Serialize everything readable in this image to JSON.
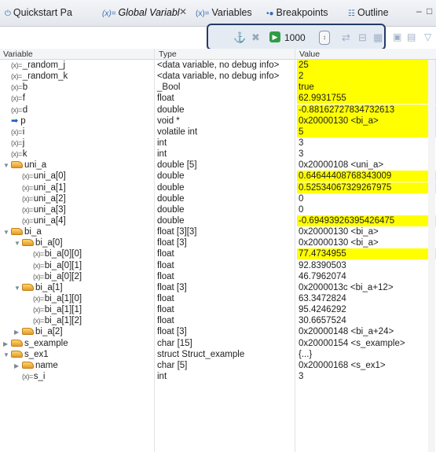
{
  "tabs": [
    {
      "label": "Quickstart Pa",
      "icon": "⏻"
    },
    {
      "label": "Global Variabl",
      "icon": "(x)="
    },
    {
      "label": "Variables",
      "icon": "(x)="
    },
    {
      "label": "Breakpoints",
      "icon": "•●"
    },
    {
      "label": "Outline",
      "icon": "☷"
    }
  ],
  "toolbar": {
    "count": "1000"
  },
  "columns": [
    "Variable",
    "Type",
    "Value"
  ],
  "rows": [
    {
      "indent": 0,
      "icon": "var",
      "name": "_random_j",
      "type": "<data variable, no debug info>",
      "value": "25",
      "hl": true
    },
    {
      "indent": 0,
      "icon": "var",
      "name": "_random_k",
      "type": "<data variable, no debug info>",
      "value": "2",
      "hl": true
    },
    {
      "indent": 0,
      "icon": "var",
      "name": "b",
      "type": "_Bool",
      "value": "true",
      "hl": true
    },
    {
      "indent": 0,
      "icon": "var",
      "name": "f",
      "type": "float",
      "value": "62.9931755",
      "hl": true
    },
    {
      "indent": 0,
      "icon": "var",
      "name": "d",
      "type": "double",
      "value": "-0.88162727834732613",
      "hl": true
    },
    {
      "indent": 0,
      "icon": "ptr",
      "name": "p",
      "type": "void *",
      "value": "0x20000130 <bi_a>",
      "hl": true
    },
    {
      "indent": 0,
      "icon": "var",
      "name": "i",
      "type": "volatile int",
      "value": "5",
      "hl": true
    },
    {
      "indent": 0,
      "icon": "var",
      "name": "j",
      "type": "int",
      "value": "3",
      "hl": false
    },
    {
      "indent": 0,
      "icon": "var",
      "name": "k",
      "type": "int",
      "value": "3",
      "hl": false
    },
    {
      "indent": 0,
      "icon": "folder",
      "expand": "open",
      "name": "uni_a",
      "type": "double [5]",
      "value": "0x20000108 <uni_a>",
      "hl": false
    },
    {
      "indent": 1,
      "icon": "var",
      "name": "uni_a[0]",
      "type": "double",
      "value": "0.64644408768343009",
      "hl": true
    },
    {
      "indent": 1,
      "icon": "var",
      "name": "uni_a[1]",
      "type": "double",
      "value": "0.52534067329267975",
      "hl": true
    },
    {
      "indent": 1,
      "icon": "var",
      "name": "uni_a[2]",
      "type": "double",
      "value": "0",
      "hl": false
    },
    {
      "indent": 1,
      "icon": "var",
      "name": "uni_a[3]",
      "type": "double",
      "value": "0",
      "hl": false
    },
    {
      "indent": 1,
      "icon": "var",
      "name": "uni_a[4]",
      "type": "double",
      "value": "-0.69493926395426475",
      "hl": true
    },
    {
      "indent": 0,
      "icon": "folder",
      "expand": "open",
      "name": "bi_a",
      "type": "float [3][3]",
      "value": "0x20000130 <bi_a>",
      "hl": false
    },
    {
      "indent": 1,
      "icon": "folder",
      "expand": "open",
      "name": "bi_a[0]",
      "type": "float [3]",
      "value": "0x20000130 <bi_a>",
      "hl": false
    },
    {
      "indent": 2,
      "icon": "var",
      "name": "bi_a[0][0]",
      "type": "float",
      "value": "77.4734955",
      "hl": true
    },
    {
      "indent": 2,
      "icon": "var",
      "name": "bi_a[0][1]",
      "type": "float",
      "value": "92.8390503",
      "hl": false
    },
    {
      "indent": 2,
      "icon": "var",
      "name": "bi_a[0][2]",
      "type": "float",
      "value": "46.7962074",
      "hl": false
    },
    {
      "indent": 1,
      "icon": "folder",
      "expand": "open",
      "name": "bi_a[1]",
      "type": "float [3]",
      "value": "0x2000013c <bi_a+12>",
      "hl": false
    },
    {
      "indent": 2,
      "icon": "var",
      "name": "bi_a[1][0]",
      "type": "float",
      "value": "63.3472824",
      "hl": false
    },
    {
      "indent": 2,
      "icon": "var",
      "name": "bi_a[1][1]",
      "type": "float",
      "value": "95.4246292",
      "hl": false
    },
    {
      "indent": 2,
      "icon": "var",
      "name": "bi_a[1][2]",
      "type": "float",
      "value": "30.6657524",
      "hl": false
    },
    {
      "indent": 1,
      "icon": "folder",
      "expand": "closed",
      "name": "bi_a[2]",
      "type": "float [3]",
      "value": "0x20000148 <bi_a+24>",
      "hl": false
    },
    {
      "indent": 0,
      "icon": "folder",
      "expand": "closed",
      "name": "s_example",
      "type": "char [15]",
      "value": "0x20000154 <s_example>",
      "hl": false
    },
    {
      "indent": 0,
      "icon": "folder",
      "expand": "open",
      "name": "s_ex1",
      "type": "struct Struct_example",
      "value": "{...}",
      "hl": false
    },
    {
      "indent": 1,
      "icon": "folder",
      "expand": "closed",
      "name": "name",
      "type": "char [5]",
      "value": "0x20000168 <s_ex1>",
      "hl": false
    },
    {
      "indent": 1,
      "icon": "var",
      "name": "s_i",
      "type": "int",
      "value": "3",
      "hl": false
    }
  ]
}
